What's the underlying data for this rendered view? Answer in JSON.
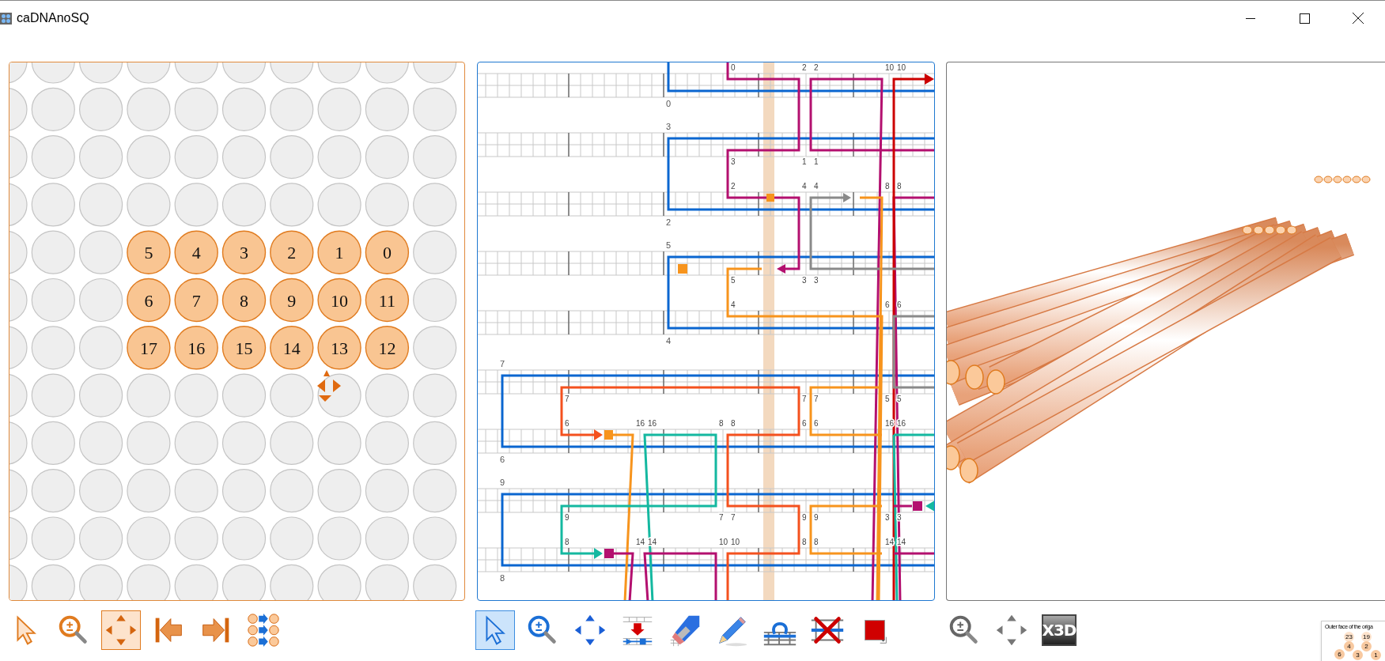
{
  "window": {
    "title": "caDNAnoSQ"
  },
  "slice_view": {
    "helices": [
      {
        "label": "5"
      },
      {
        "label": "4"
      },
      {
        "label": "3"
      },
      {
        "label": "2"
      },
      {
        "label": "1"
      },
      {
        "label": "0"
      },
      {
        "label": "6"
      },
      {
        "label": "7"
      },
      {
        "label": "8"
      },
      {
        "label": "9"
      },
      {
        "label": "10"
      },
      {
        "label": "11"
      },
      {
        "label": "17"
      },
      {
        "label": "16"
      },
      {
        "label": "15"
      },
      {
        "label": "14"
      },
      {
        "label": "13"
      },
      {
        "label": "12"
      }
    ]
  },
  "path_view": {
    "helices": [
      {
        "number": "0",
        "labels": [
          "0",
          "2",
          "2",
          "10",
          "10"
        ]
      },
      {
        "number": "3",
        "labels": [
          "3",
          "1",
          "1"
        ]
      },
      {
        "number": "2",
        "labels": [
          "2",
          "4",
          "4",
          "8",
          "8"
        ]
      },
      {
        "number": "5",
        "labels": [
          "5",
          "3",
          "3"
        ]
      },
      {
        "number": "4",
        "labels": [
          "4",
          "6",
          "6"
        ]
      },
      {
        "number": "7",
        "labels": [
          "7",
          "7",
          "7",
          "5",
          "5"
        ]
      },
      {
        "number": "6",
        "labels": [
          "6",
          "16",
          "16",
          "8",
          "8",
          "6",
          "6",
          "16",
          "16"
        ]
      },
      {
        "number": "9",
        "labels": [
          "9",
          "7",
          "7",
          "9",
          "9",
          "3",
          "3"
        ]
      },
      {
        "number": "8",
        "labels": [
          "8",
          "14",
          "14",
          "10",
          "10",
          "8",
          "8",
          "14",
          "14"
        ]
      }
    ]
  },
  "toolbars": [
    {
      "buttons": [
        {
          "kind": "select",
          "selected": false
        },
        {
          "kind": "zoom",
          "selected": false
        },
        {
          "kind": "pan",
          "selected": true
        },
        {
          "kind": "first",
          "selected": false
        },
        {
          "kind": "last",
          "selected": false
        },
        {
          "kind": "renumber",
          "selected": false
        }
      ]
    },
    {
      "buttons": [
        {
          "kind": "select",
          "selected": true
        },
        {
          "kind": "zoom",
          "selected": false
        },
        {
          "kind": "pan",
          "selected": false
        },
        {
          "kind": "break",
          "selected": false
        },
        {
          "kind": "erase",
          "selected": false
        },
        {
          "kind": "pencil",
          "selected": false
        },
        {
          "kind": "loop",
          "selected": false
        },
        {
          "kind": "skip",
          "selected": false
        },
        {
          "kind": "paint",
          "selected": false
        }
      ]
    },
    {
      "buttons": [
        {
          "kind": "zoom",
          "selected": false
        },
        {
          "kind": "pan",
          "selected": false
        },
        {
          "kind": "x3d",
          "selected": false,
          "label": "X3D"
        }
      ]
    }
  ],
  "inset_figure": {
    "title": "Outer face of the origa",
    "circles": [
      {
        "label": "23",
        "color": "#fde3cc"
      },
      {
        "label": "19",
        "color": "#fde3cc"
      },
      {
        "label": "4",
        "color": "#f8c9a0"
      },
      {
        "label": "2",
        "color": "#f8c9a0"
      },
      {
        "label": "6",
        "color": "#f8c9a0"
      },
      {
        "label": "3",
        "color": "#f8c9a0"
      },
      {
        "label": "1",
        "color": "#f8c9a0"
      }
    ]
  }
}
